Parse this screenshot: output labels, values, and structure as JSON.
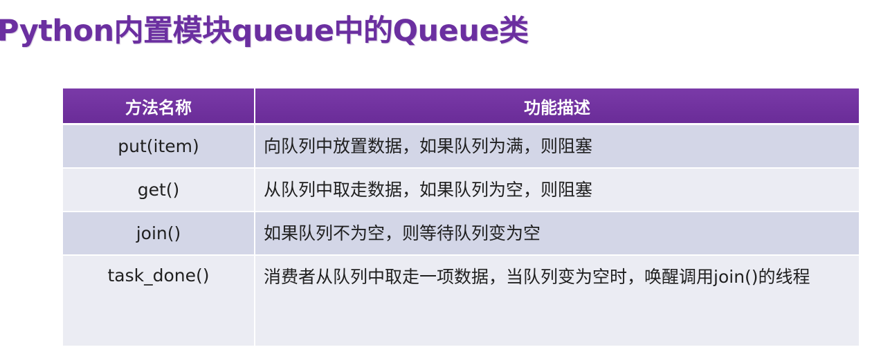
{
  "slide": {
    "title": "Python内置模块queue中的Queue类"
  },
  "table": {
    "headers": [
      "方法名称",
      "功能描述"
    ],
    "rows": [
      {
        "method": "put(item)",
        "description": "向队列中放置数据，如果队列为满，则阻塞"
      },
      {
        "method": "get()",
        "description": "从队列中取走数据，如果队列为空，则阻塞"
      },
      {
        "method": "join()",
        "description": "如果队列不为空，则等待队列变为空"
      },
      {
        "method": "task_done()",
        "description": "消费者从队列中取走一项数据，当队列变为空时，唤醒调用join()的线程"
      }
    ]
  },
  "colors": {
    "title": "#6b2fa0",
    "header_bg": "#6a2c98",
    "row_odd_bg": "#d3d6e7",
    "row_even_bg": "#ebecf3"
  }
}
